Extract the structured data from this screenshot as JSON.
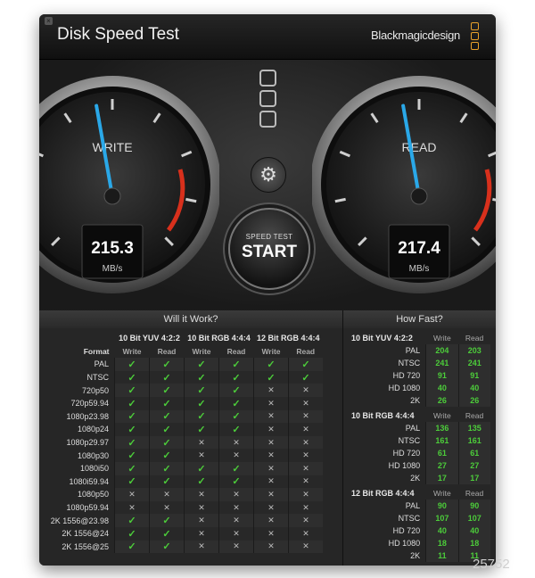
{
  "window": {
    "title": "Disk Speed Test",
    "brand": "Blackmagicdesign"
  },
  "gauges": [
    {
      "label": "WRITE",
      "value": "215.3",
      "unit": "MB/s",
      "needle_deg": -10
    },
    {
      "label": "READ",
      "value": "217.4",
      "unit": "MB/s",
      "needle_deg": -10
    }
  ],
  "start": {
    "line1": "SPEED TEST",
    "line2": "START"
  },
  "will_it_work": {
    "title": "Will it Work?",
    "format_label": "Format",
    "groups": [
      "10 Bit YUV 4:2:2",
      "10 Bit RGB 4:4:4",
      "12 Bit RGB 4:4:4"
    ],
    "sub": [
      "Write",
      "Read"
    ],
    "rows": [
      {
        "format": "PAL",
        "marks": [
          1,
          1,
          1,
          1,
          1,
          1
        ]
      },
      {
        "format": "NTSC",
        "marks": [
          1,
          1,
          1,
          1,
          1,
          1
        ]
      },
      {
        "format": "720p50",
        "marks": [
          1,
          1,
          1,
          1,
          0,
          0
        ]
      },
      {
        "format": "720p59.94",
        "marks": [
          1,
          1,
          1,
          1,
          0,
          0
        ]
      },
      {
        "format": "1080p23.98",
        "marks": [
          1,
          1,
          1,
          1,
          0,
          0
        ]
      },
      {
        "format": "1080p24",
        "marks": [
          1,
          1,
          1,
          1,
          0,
          0
        ]
      },
      {
        "format": "1080p29.97",
        "marks": [
          1,
          1,
          0,
          0,
          0,
          0
        ]
      },
      {
        "format": "1080p30",
        "marks": [
          1,
          1,
          0,
          0,
          0,
          0
        ]
      },
      {
        "format": "1080i50",
        "marks": [
          1,
          1,
          1,
          1,
          0,
          0
        ]
      },
      {
        "format": "1080i59.94",
        "marks": [
          1,
          1,
          1,
          1,
          0,
          0
        ]
      },
      {
        "format": "1080p50",
        "marks": [
          0,
          0,
          0,
          0,
          0,
          0
        ]
      },
      {
        "format": "1080p59.94",
        "marks": [
          0,
          0,
          0,
          0,
          0,
          0
        ]
      },
      {
        "format": "2K 1556@23.98",
        "marks": [
          1,
          1,
          0,
          0,
          0,
          0
        ]
      },
      {
        "format": "2K 1556@24",
        "marks": [
          1,
          1,
          0,
          0,
          0,
          0
        ]
      },
      {
        "format": "2K 1556@25",
        "marks": [
          1,
          1,
          0,
          0,
          0,
          0
        ]
      }
    ]
  },
  "how_fast": {
    "title": "How Fast?",
    "sections": [
      {
        "name": "10 Bit YUV 4:2:2",
        "rows": [
          {
            "label": "PAL",
            "write": "204",
            "read": "203"
          },
          {
            "label": "NTSC",
            "write": "241",
            "read": "241"
          },
          {
            "label": "HD 720",
            "write": "91",
            "read": "91"
          },
          {
            "label": "HD 1080",
            "write": "40",
            "read": "40"
          },
          {
            "label": "2K",
            "write": "26",
            "read": "26"
          }
        ]
      },
      {
        "name": "10 Bit RGB 4:4:4",
        "rows": [
          {
            "label": "PAL",
            "write": "136",
            "read": "135"
          },
          {
            "label": "NTSC",
            "write": "161",
            "read": "161"
          },
          {
            "label": "HD 720",
            "write": "61",
            "read": "61"
          },
          {
            "label": "HD 1080",
            "write": "27",
            "read": "27"
          },
          {
            "label": "2K",
            "write": "17",
            "read": "17"
          }
        ]
      },
      {
        "name": "12 Bit RGB 4:4:4",
        "rows": [
          {
            "label": "PAL",
            "write": "90",
            "read": "90"
          },
          {
            "label": "NTSC",
            "write": "107",
            "read": "107"
          },
          {
            "label": "HD 720",
            "write": "40",
            "read": "40"
          },
          {
            "label": "HD 1080",
            "write": "18",
            "read": "18"
          },
          {
            "label": "2K",
            "write": "11",
            "read": "11"
          }
        ]
      }
    ]
  },
  "watermark": "25752"
}
